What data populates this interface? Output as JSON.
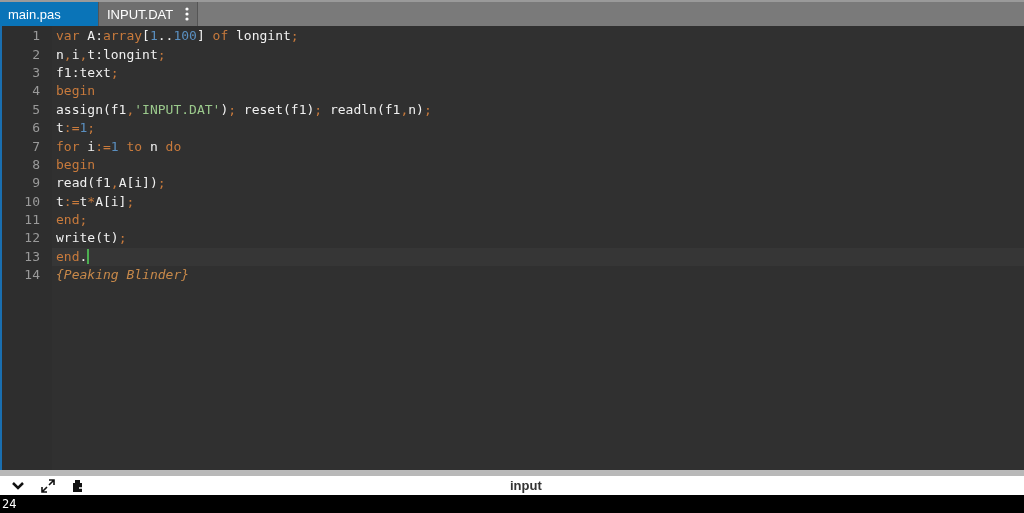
{
  "tabs": [
    {
      "label": "main.pas",
      "selected": true,
      "menu": false
    },
    {
      "label": "INPUT.DAT",
      "selected": false,
      "menu": true
    }
  ],
  "editor": {
    "lines": [
      {
        "number": "1",
        "current": false,
        "tokens": [
          {
            "kind": "kw",
            "text": "var"
          },
          {
            "kind": "plain",
            "text": " A:"
          },
          {
            "kind": "kw",
            "text": "array"
          },
          {
            "kind": "plain",
            "text": "["
          },
          {
            "kind": "num",
            "text": "1"
          },
          {
            "kind": "plain",
            "text": ".."
          },
          {
            "kind": "num",
            "text": "100"
          },
          {
            "kind": "plain",
            "text": "]"
          },
          {
            "kind": "kw",
            "text": " of"
          },
          {
            "kind": "plain",
            "text": " longint"
          },
          {
            "kind": "op",
            "text": ";"
          }
        ]
      },
      {
        "number": "2",
        "current": false,
        "tokens": [
          {
            "kind": "plain",
            "text": "n"
          },
          {
            "kind": "op",
            "text": ","
          },
          {
            "kind": "plain",
            "text": "i"
          },
          {
            "kind": "op",
            "text": ","
          },
          {
            "kind": "plain",
            "text": "t:longint"
          },
          {
            "kind": "op",
            "text": ";"
          }
        ]
      },
      {
        "number": "3",
        "current": false,
        "tokens": [
          {
            "kind": "plain",
            "text": "f1:text"
          },
          {
            "kind": "op",
            "text": ";"
          }
        ]
      },
      {
        "number": "4",
        "current": false,
        "tokens": [
          {
            "kind": "kw",
            "text": "begin"
          }
        ]
      },
      {
        "number": "5",
        "current": false,
        "tokens": [
          {
            "kind": "plain",
            "text": "assign(f1"
          },
          {
            "kind": "op",
            "text": ","
          },
          {
            "kind": "str",
            "text": "'INPUT.DAT'"
          },
          {
            "kind": "plain",
            "text": ")"
          },
          {
            "kind": "op",
            "text": ";"
          },
          {
            "kind": "plain",
            "text": " reset(f1)"
          },
          {
            "kind": "op",
            "text": ";"
          },
          {
            "kind": "plain",
            "text": " readln(f1"
          },
          {
            "kind": "op",
            "text": ","
          },
          {
            "kind": "plain",
            "text": "n)"
          },
          {
            "kind": "op",
            "text": ";"
          }
        ]
      },
      {
        "number": "6",
        "current": false,
        "tokens": [
          {
            "kind": "plain",
            "text": "t"
          },
          {
            "kind": "op",
            "text": ":="
          },
          {
            "kind": "num",
            "text": "1"
          },
          {
            "kind": "op",
            "text": ";"
          }
        ]
      },
      {
        "number": "7",
        "current": false,
        "tokens": [
          {
            "kind": "kw",
            "text": "for"
          },
          {
            "kind": "plain",
            "text": " i"
          },
          {
            "kind": "op",
            "text": ":="
          },
          {
            "kind": "num",
            "text": "1"
          },
          {
            "kind": "kw",
            "text": " to"
          },
          {
            "kind": "plain",
            "text": " n"
          },
          {
            "kind": "kw",
            "text": " do"
          }
        ]
      },
      {
        "number": "8",
        "current": false,
        "tokens": [
          {
            "kind": "kw",
            "text": "begin"
          }
        ]
      },
      {
        "number": "9",
        "current": false,
        "tokens": [
          {
            "kind": "plain",
            "text": "read(f1"
          },
          {
            "kind": "op",
            "text": ","
          },
          {
            "kind": "plain",
            "text": "A[i])"
          },
          {
            "kind": "op",
            "text": ";"
          }
        ]
      },
      {
        "number": "10",
        "current": false,
        "tokens": [
          {
            "kind": "plain",
            "text": "t"
          },
          {
            "kind": "op",
            "text": ":="
          },
          {
            "kind": "plain",
            "text": "t"
          },
          {
            "kind": "op",
            "text": "*"
          },
          {
            "kind": "plain",
            "text": "A[i]"
          },
          {
            "kind": "op",
            "text": ";"
          }
        ]
      },
      {
        "number": "11",
        "current": false,
        "tokens": [
          {
            "kind": "kw",
            "text": "end"
          },
          {
            "kind": "op",
            "text": ";"
          }
        ]
      },
      {
        "number": "12",
        "current": false,
        "tokens": [
          {
            "kind": "plain",
            "text": "write(t)"
          },
          {
            "kind": "op",
            "text": ";"
          }
        ]
      },
      {
        "number": "13",
        "current": true,
        "tokens": [
          {
            "kind": "kw",
            "text": "end"
          },
          {
            "kind": "plain",
            "text": "."
          }
        ]
      },
      {
        "number": "14",
        "current": false,
        "tokens": [
          {
            "kind": "comment",
            "text": "{Peaking Blinder}"
          }
        ]
      }
    ]
  },
  "panel": {
    "title": "input",
    "output": "24"
  }
}
